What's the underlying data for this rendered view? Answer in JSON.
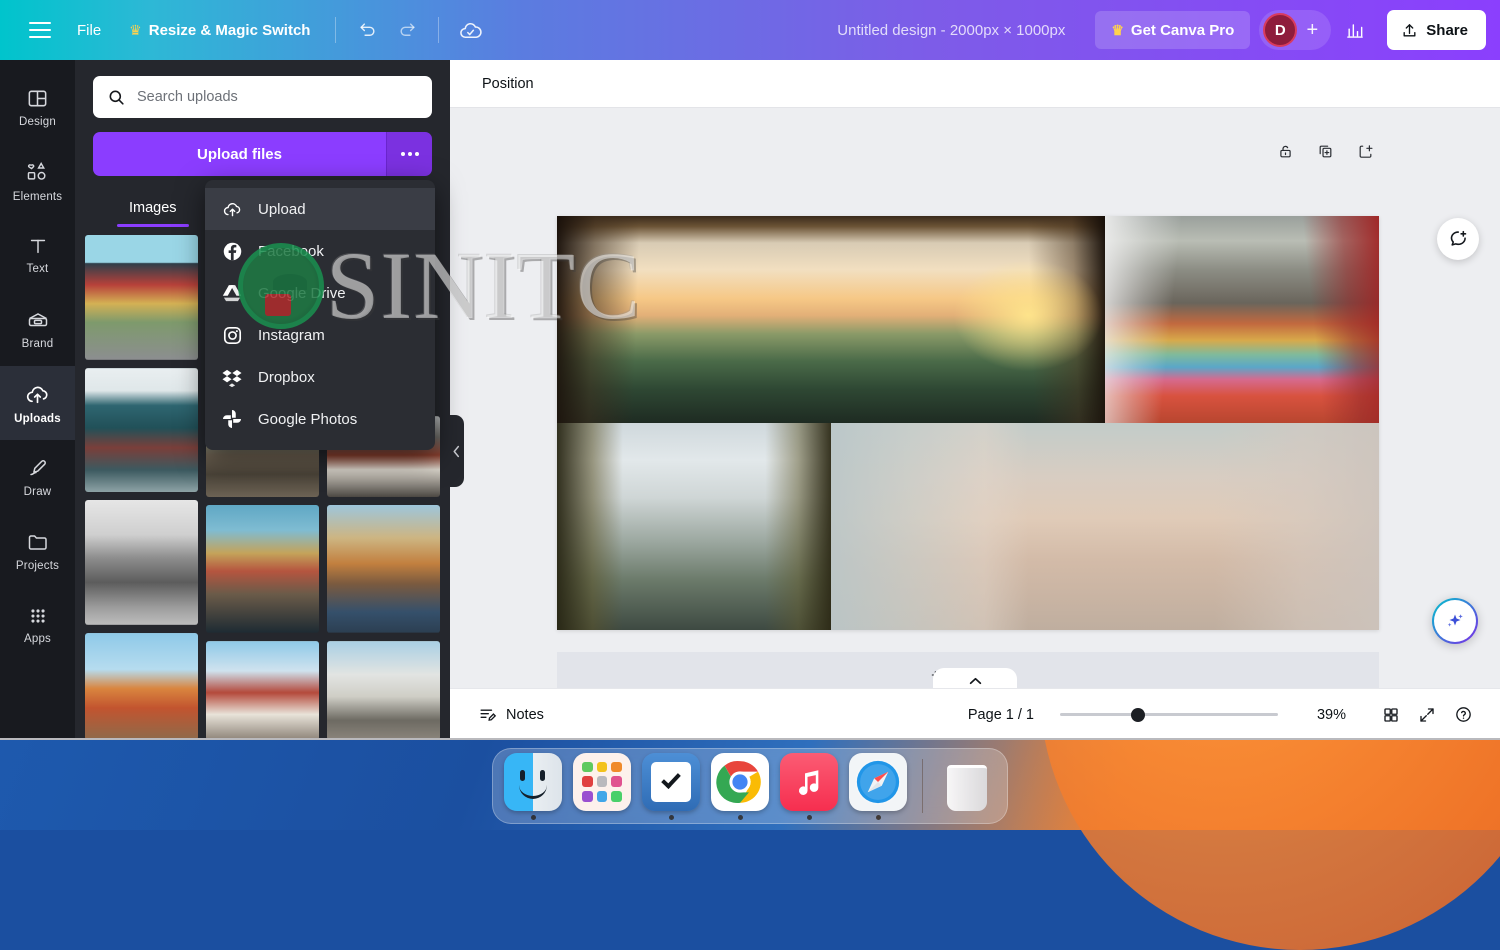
{
  "topbar": {
    "menu_icon": "hamburger-icon",
    "file_label": "File",
    "magic_switch_label": "Resize & Magic Switch",
    "crown_glyph": "♛",
    "undo_icon": "undo-icon",
    "redo_icon": "redo-icon",
    "cloud_icon": "cloud-saved-icon",
    "design_title": "Untitled design - 2000px × 1000px",
    "get_pro_label": "Get Canva Pro",
    "avatar_initial": "D",
    "add_person_glyph": "+",
    "insights_icon": "bar-chart-icon",
    "share_label": "Share",
    "share_icon": "upload-share-icon"
  },
  "rail": {
    "items": [
      {
        "label": "Design",
        "icon": "layout-icon",
        "active": false
      },
      {
        "label": "Elements",
        "icon": "shapes-icon",
        "active": false
      },
      {
        "label": "Text",
        "icon": "text-t-icon",
        "active": false
      },
      {
        "label": "Brand",
        "icon": "brand-kit-icon",
        "active": false
      },
      {
        "label": "Uploads",
        "icon": "upload-cloud-icon",
        "active": true
      },
      {
        "label": "Draw",
        "icon": "pen-draw-icon",
        "active": false
      },
      {
        "label": "Projects",
        "icon": "folder-icon",
        "active": false
      },
      {
        "label": "Apps",
        "icon": "grid-apps-icon",
        "active": false
      }
    ]
  },
  "panel": {
    "search": {
      "placeholder": "Search uploads",
      "value": "",
      "icon": "search-icon"
    },
    "upload_button_label": "Upload files",
    "upload_more_icon": "ellipsis-icon",
    "tabs": [
      {
        "label": "Images",
        "active": true
      }
    ],
    "collapse_icon": "chevron-left-icon"
  },
  "dropdown": {
    "items": [
      {
        "label": "Upload",
        "icon": "upload-cloud-icon",
        "hovered": true
      },
      {
        "label": "Facebook",
        "icon": "facebook-icon",
        "hovered": false
      },
      {
        "label": "Google Drive",
        "icon": "google-drive-icon",
        "hovered": false
      },
      {
        "label": "Instagram",
        "icon": "instagram-icon",
        "hovered": false
      },
      {
        "label": "Dropbox",
        "icon": "dropbox-icon",
        "hovered": false
      },
      {
        "label": "Google Photos",
        "icon": "google-photos-icon",
        "hovered": false
      }
    ]
  },
  "editor": {
    "position_label": "Position",
    "page_tools": [
      {
        "icon": "lock-icon"
      },
      {
        "icon": "duplicate-page-icon"
      },
      {
        "icon": "add-page-after-icon"
      }
    ],
    "add_page_label": "+ Add page",
    "comment_fab_icon": "add-comment-icon",
    "magic_fab_icon": "magic-sparkle-icon",
    "scroll_tab_icon": "chevron-up-icon"
  },
  "statusbar": {
    "notes_label": "Notes",
    "notes_icon": "notes-icon",
    "page_count": "Page 1 / 1",
    "zoom_value": "39%",
    "zoom_position_percent": 36,
    "grid_view_icon": "grid-view-icon",
    "fullscreen_icon": "expand-fullscreen-icon",
    "help_icon": "help-circle-icon"
  },
  "watermark": {
    "text": "SINITC",
    "logo": "circular-green-logo"
  },
  "dock": {
    "apps": [
      {
        "name": "Finder",
        "icon": "finder-icon",
        "running": true
      },
      {
        "name": "Launchpad",
        "icon": "launchpad-icon",
        "running": false
      },
      {
        "name": "Things",
        "icon": "things-check-icon",
        "running": true
      },
      {
        "name": "Chrome",
        "icon": "chrome-icon",
        "running": true
      },
      {
        "name": "Music",
        "icon": "music-note-icon",
        "running": true
      },
      {
        "name": "Safari",
        "icon": "safari-compass-icon",
        "running": true
      }
    ],
    "trash": {
      "name": "Trash",
      "icon": "trash-icon",
      "running": false
    }
  },
  "colors": {
    "brand_purple": "#8b3dff",
    "teal": "#00c4cc",
    "panel_dark": "#25272d",
    "rail_dark": "#181a1f",
    "dropdown_dark": "#2b2d33",
    "canvas_gray": "#edeef1",
    "avatar_maroon": "#8e1d3c"
  },
  "canvas_images": {
    "top_left": "waterfall-cave-sunset",
    "top_right": "rainbow-street-church",
    "bottom_left": "skogafoss-rainbow-waterfall",
    "bottom_right": "iceland-photo-collage"
  },
  "thumbnails": {
    "col1": [
      "colorful-street-houses",
      "teal-street-scene",
      "bw-bicycle-square",
      "blue-sky-rooftops"
    ],
    "col2": [
      "cobblestone-alley",
      "nyhavn-harbour-boats",
      "red-roof-town"
    ],
    "col3": [
      "rain-umbrellas",
      "harbour-man-coat",
      "white-house-facade"
    ]
  }
}
